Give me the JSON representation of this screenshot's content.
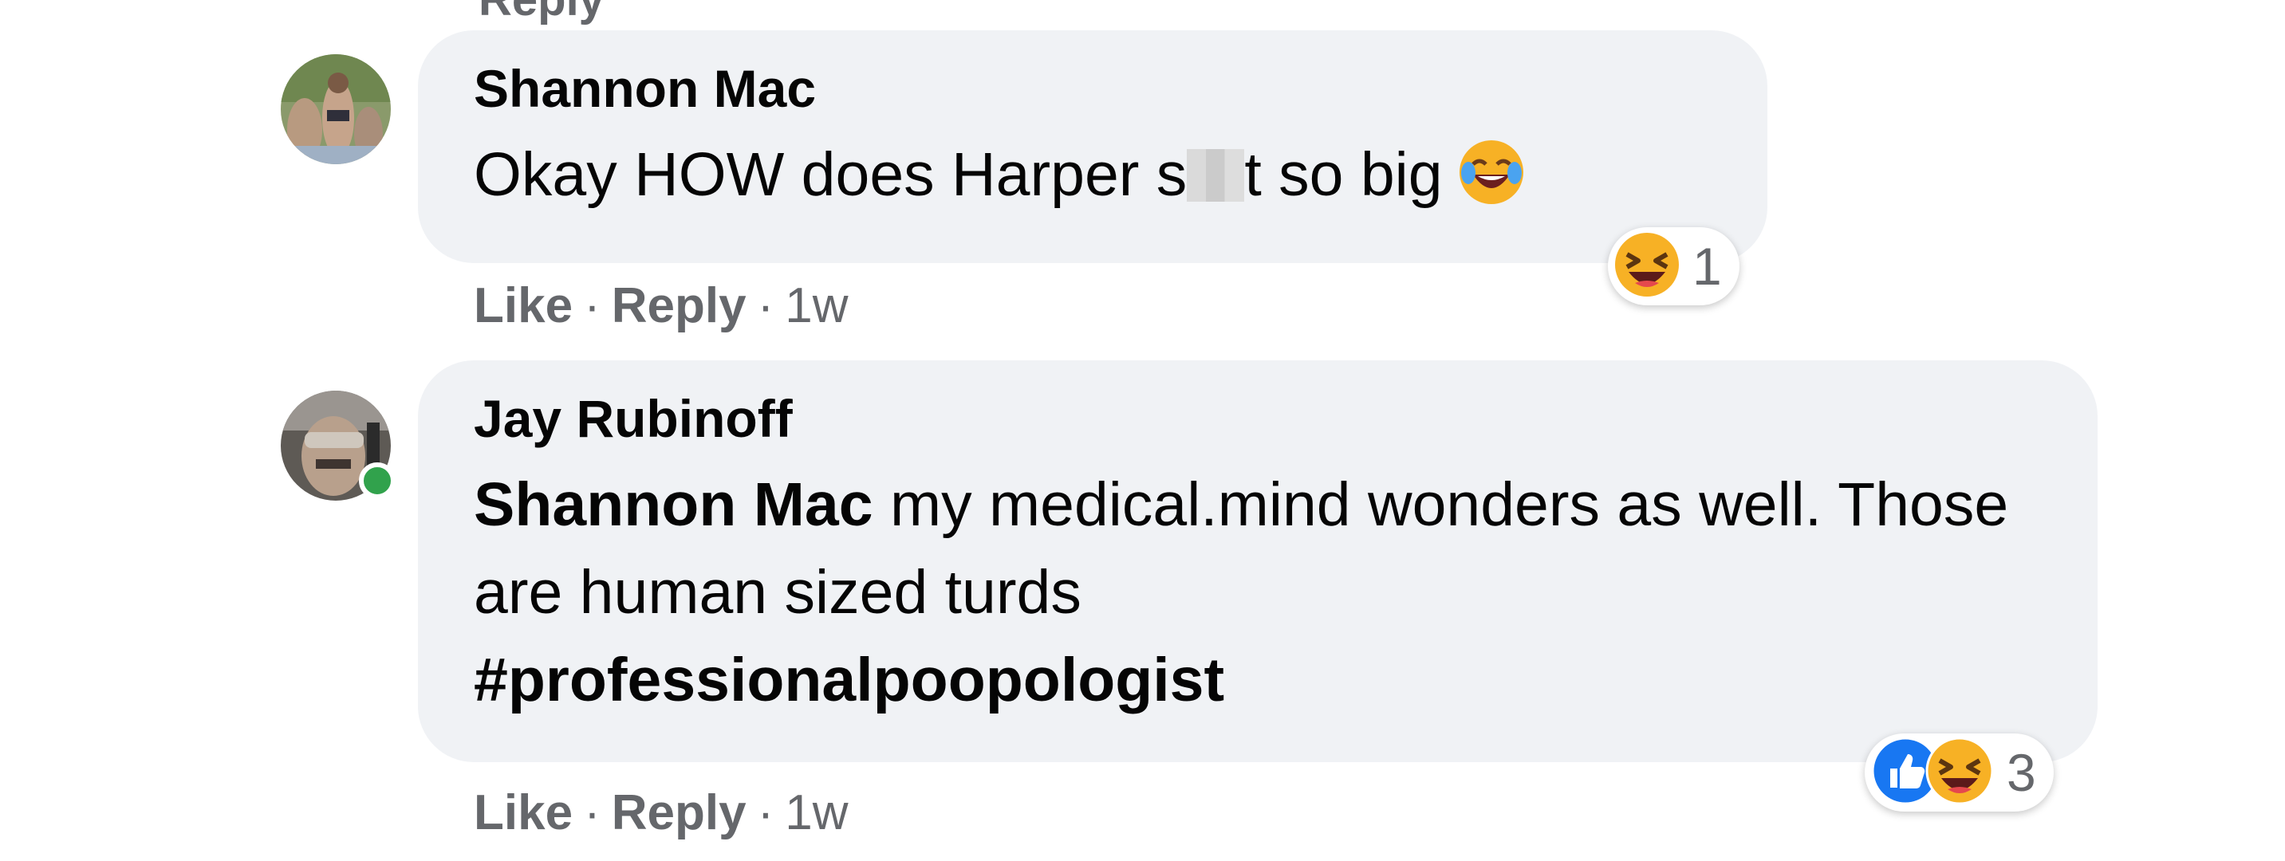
{
  "colors": {
    "bubble_bg": "#f0f2f5",
    "meta_text": "#65676b",
    "online": "#31a24c",
    "like_blue": "#1877f2",
    "haha_yellow": "#f7b125"
  },
  "comments": [
    {
      "author": "Shannon Mac",
      "text_before_blur": "Okay HOW does Harper s",
      "text_after_blur": "t so big",
      "inline_emoji": "face-with-tears-of-joy-icon",
      "reactions": {
        "icons": [
          "haha-icon"
        ],
        "count": "1"
      },
      "actions": {
        "like": "Like",
        "reply": "Reply",
        "separator": "·",
        "time": "1w"
      }
    },
    {
      "author": "Jay Rubinoff",
      "online": true,
      "mention": "Shannon Mac",
      "text": " my medical.mind wonders as well. Those are human sized turds",
      "hashtag": "#professionalpoopologist",
      "reactions": {
        "icons": [
          "like-icon",
          "haha-icon"
        ],
        "count": "3"
      },
      "actions": {
        "like": "Like",
        "reply": "Reply",
        "separator": "·",
        "time": "1w"
      }
    }
  ],
  "clipped_above": {
    "text": "Reply"
  }
}
